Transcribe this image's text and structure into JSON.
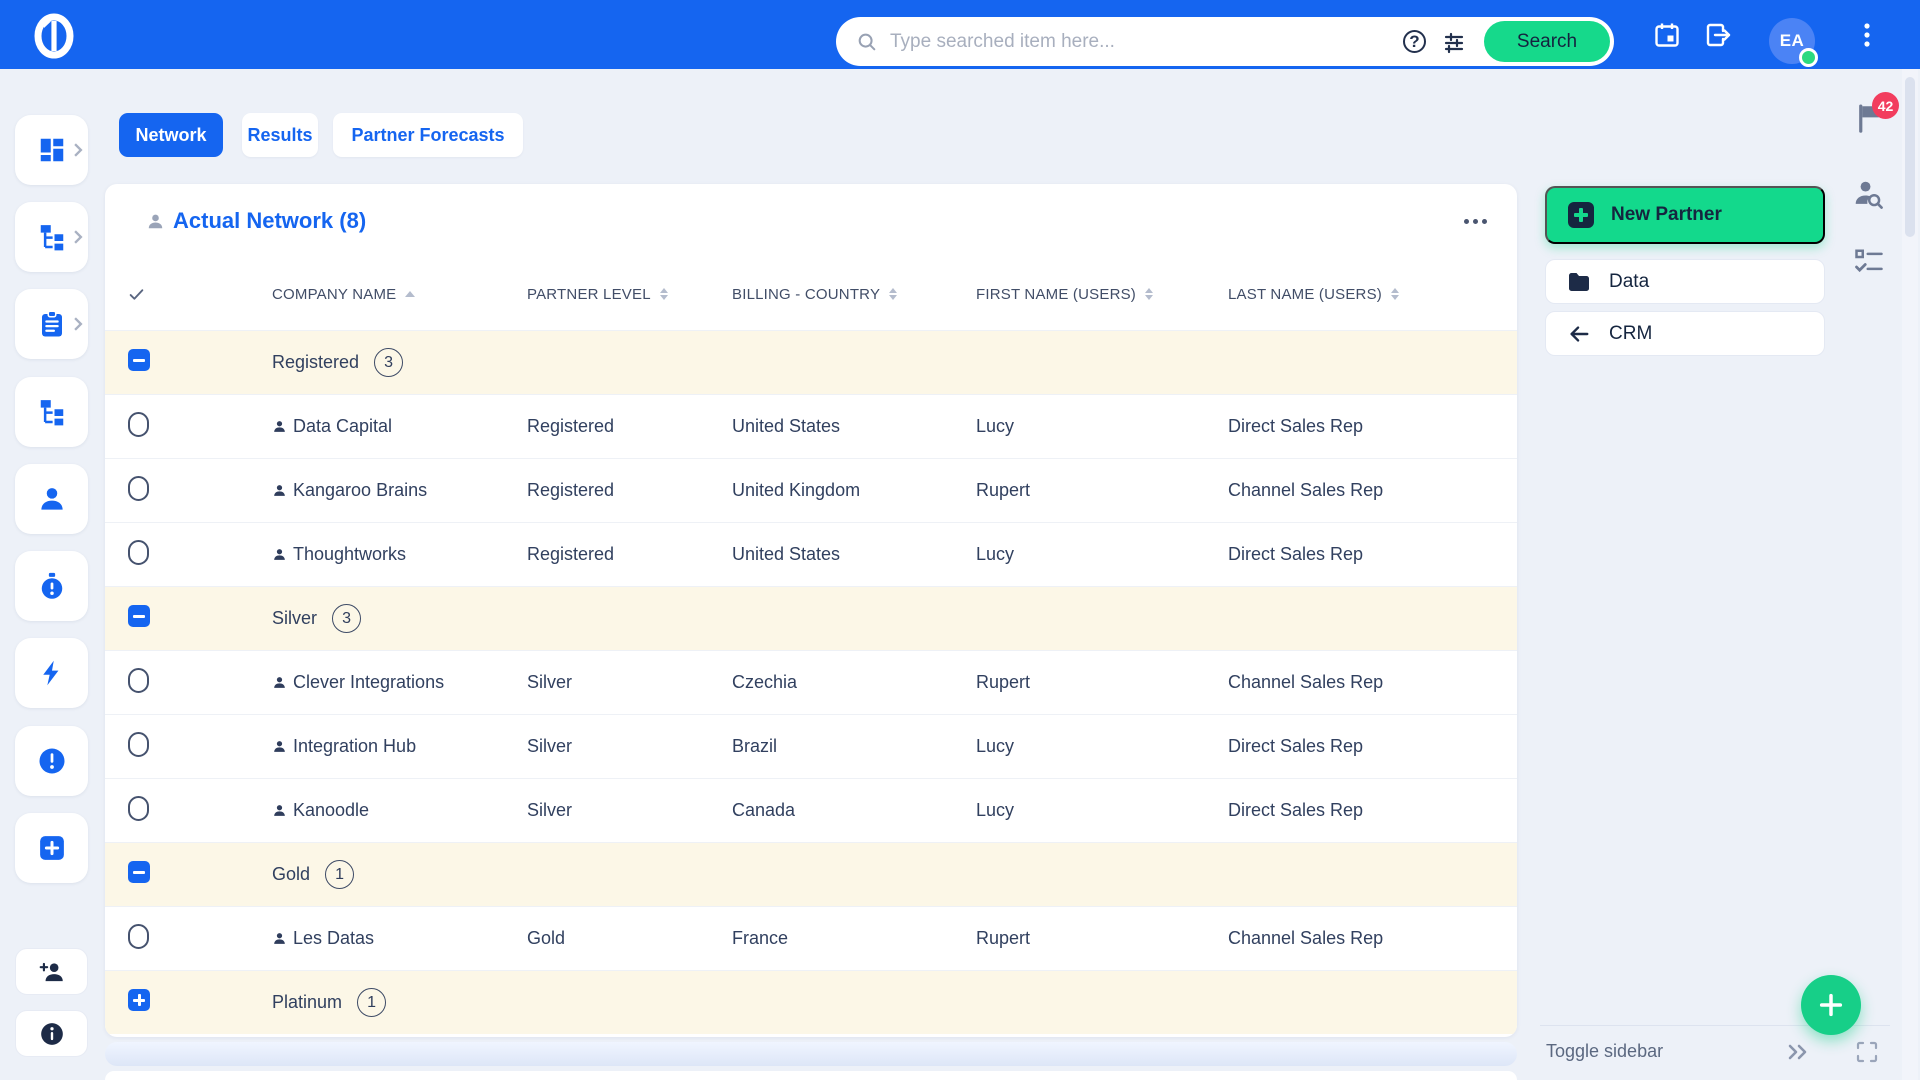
{
  "header": {
    "search_placeholder": "Type searched item here...",
    "search_button": "Search",
    "avatar_initials": "EA"
  },
  "flag_badge": "42",
  "tabs": {
    "network": "Network",
    "results": "Results",
    "partner_forecasts": "Partner Forecasts"
  },
  "table": {
    "title": "Actual Network (8)",
    "columns": {
      "company": "COMPANY NAME",
      "level": "PARTNER LEVEL",
      "country": "BILLING - COUNTRY",
      "first": "FIRST NAME (USERS)",
      "last": "LAST NAME (USERS)"
    },
    "groups": [
      {
        "label": "Registered",
        "count": "3",
        "rows": [
          {
            "company": "Data Capital",
            "level": "Registered",
            "country": "United States",
            "first": "Lucy",
            "last": "Direct Sales Rep"
          },
          {
            "company": "Kangaroo Brains",
            "level": "Registered",
            "country": "United Kingdom",
            "first": "Rupert",
            "last": "Channel Sales Rep"
          },
          {
            "company": "Thoughtworks",
            "level": "Registered",
            "country": "United States",
            "first": "Lucy",
            "last": "Direct Sales Rep"
          }
        ]
      },
      {
        "label": "Silver",
        "count": "3",
        "rows": [
          {
            "company": "Clever Integrations",
            "level": "Silver",
            "country": "Czechia",
            "first": "Rupert",
            "last": "Channel Sales Rep"
          },
          {
            "company": "Integration Hub",
            "level": "Silver",
            "country": "Brazil",
            "first": "Lucy",
            "last": "Direct Sales Rep"
          },
          {
            "company": "Kanoodle",
            "level": "Silver",
            "country": "Canada",
            "first": "Lucy",
            "last": "Direct Sales Rep"
          }
        ]
      },
      {
        "label": "Gold",
        "count": "1",
        "rows": [
          {
            "company": "Les Datas",
            "level": "Gold",
            "country": "France",
            "first": "Rupert",
            "last": "Channel Sales Rep"
          }
        ]
      },
      {
        "label": "Platinum",
        "count": "1",
        "rows": []
      }
    ]
  },
  "right_panel": {
    "new_partner": "New Partner",
    "data": "Data",
    "crm": "CRM"
  },
  "footer": {
    "toggle_sidebar": "Toggle sidebar"
  },
  "icons": [
    "dashboard",
    "hierarchy",
    "clipboard",
    "hierarchy",
    "person",
    "stopwatch",
    "lightning",
    "alert",
    "add-square",
    "person-add",
    "info",
    "flag",
    "person-search",
    "tasks",
    "calendar",
    "export",
    "kebab-menu",
    "search",
    "help",
    "filter-sliders",
    "expand",
    "double-chevron-right",
    "plus-fab"
  ],
  "colors": {
    "header_blue": "#1565f0",
    "accent_green": "#16d98b",
    "group_row_bg": "#fcf7e7",
    "badge_red": "#f23d5e",
    "text_navy": "#2c3a57",
    "link_blue": "#1565f0"
  }
}
